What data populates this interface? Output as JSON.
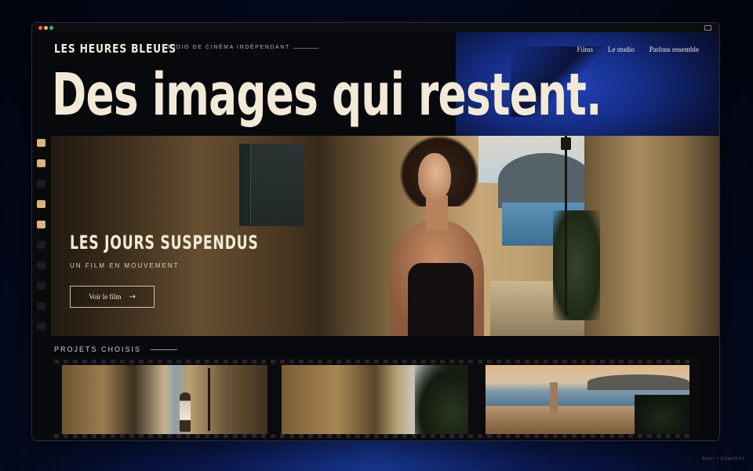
{
  "brand": {
    "name": "LES HEURES BLEUES",
    "tagline": "STUDIO DE CINÉMA INDÉPENDANT"
  },
  "nav": {
    "items": [
      "Films",
      "Le studio",
      "Parlons ensemble"
    ]
  },
  "hero": {
    "headline": "Des images qui restent.",
    "title": "LES JOURS SUSPENDUS",
    "subtitle": "UN FILM EN MOUVEMENT",
    "cta_label": "Voir le film",
    "cta_icon": "arrow-right-icon"
  },
  "projects": {
    "label": "PROJETS CHOISIS",
    "count": 3
  },
  "footer": {
    "watermark": "BOKI / CONCEPT"
  },
  "colors": {
    "cream": "#f2ead6",
    "accent_blue": "#2446c8",
    "film_black": "#0b0b0d",
    "perforation_lit": "#d9b57a"
  }
}
